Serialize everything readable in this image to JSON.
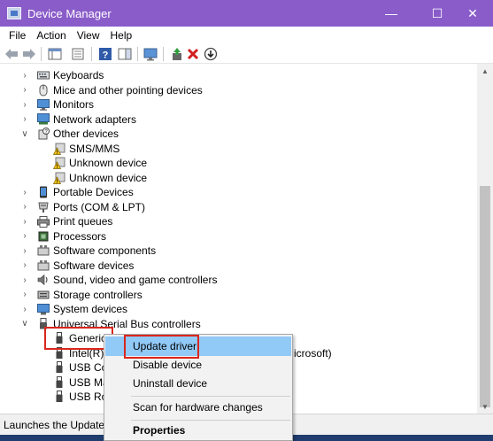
{
  "window": {
    "title": "Device Manager",
    "minimize_glyph": "—",
    "maximize_glyph": "☐",
    "close_glyph": "✕"
  },
  "menubar": {
    "file": "File",
    "action": "Action",
    "view": "View",
    "help": "Help"
  },
  "tree": {
    "rows": [
      {
        "label": "Keyboards",
        "expander": "collapsed",
        "icon": "keyboard-icon"
      },
      {
        "label": "Mice and other pointing devices",
        "expander": "collapsed",
        "icon": "mouse-icon"
      },
      {
        "label": "Monitors",
        "expander": "collapsed",
        "icon": "monitor-icon"
      },
      {
        "label": "Network adapters",
        "expander": "collapsed",
        "icon": "network-adapter-icon"
      },
      {
        "label": "Other devices",
        "expander": "expanded",
        "icon": "unknown-device-category-icon"
      },
      {
        "label": "SMS/MMS",
        "icon": "device-warning-icon"
      },
      {
        "label": "Unknown device",
        "icon": "device-warning-icon"
      },
      {
        "label": "Unknown device",
        "icon": "device-warning-icon"
      },
      {
        "label": "Portable Devices",
        "expander": "collapsed",
        "icon": "portable-device-icon"
      },
      {
        "label": "Ports (COM & LPT)",
        "expander": "collapsed",
        "icon": "port-icon"
      },
      {
        "label": "Print queues",
        "expander": "collapsed",
        "icon": "printer-icon"
      },
      {
        "label": "Processors",
        "expander": "collapsed",
        "icon": "processor-icon"
      },
      {
        "label": "Software components",
        "expander": "collapsed",
        "icon": "software-component-icon"
      },
      {
        "label": "Software devices",
        "expander": "collapsed",
        "icon": "software-device-icon"
      },
      {
        "label": "Sound, video and game controllers",
        "expander": "collapsed",
        "icon": "speaker-icon"
      },
      {
        "label": "Storage controllers",
        "expander": "collapsed",
        "icon": "storage-controller-icon"
      },
      {
        "label": "System devices",
        "expander": "collapsed",
        "icon": "system-device-icon"
      },
      {
        "label": "Universal Serial Bus controllers",
        "expander": "expanded",
        "icon": "usb-icon"
      },
      {
        "label": "Generic",
        "icon": "usb-plug-icon",
        "selected": true
      },
      {
        "label": "Intel(R) U",
        "icon": "usb-plug-icon"
      },
      {
        "label": "USB Cor",
        "icon": "usb-plug-icon"
      },
      {
        "label": "USB Mas",
        "icon": "usb-plug-icon"
      },
      {
        "label": "USB Roo",
        "icon": "usb-plug-icon"
      }
    ],
    "peek_right": "icrosoft)"
  },
  "context_menu": {
    "items": [
      "Update driver",
      "Disable device",
      "Uninstall device",
      "Scan for hardware changes",
      "Properties"
    ],
    "highlighted": "Update driver"
  },
  "status": {
    "text": "Launches the Update Dr"
  },
  "colors": {
    "titlebar": "#8a5cc9",
    "menu_highlight": "#91c9f7",
    "annotation_red": "#d9261c"
  }
}
